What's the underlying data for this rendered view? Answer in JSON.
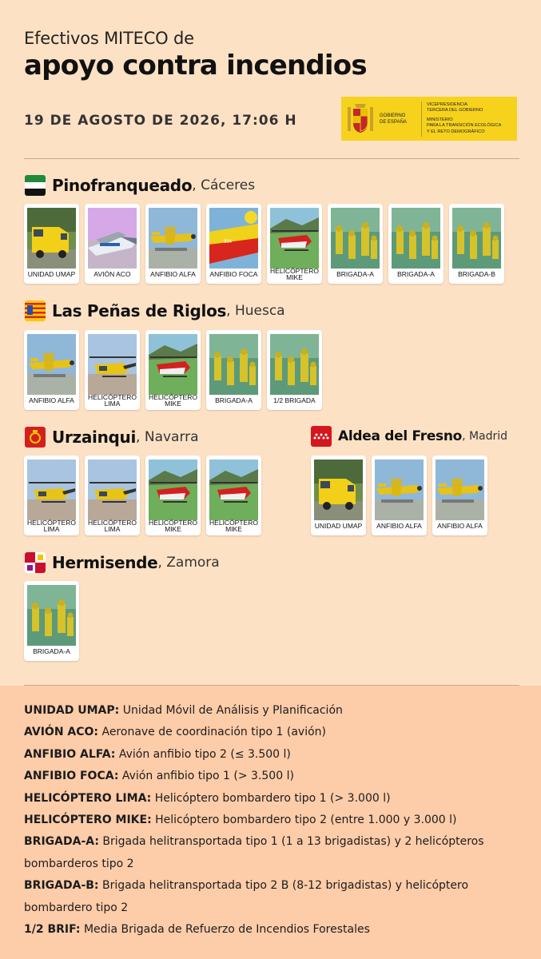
{
  "header": {
    "subtitle": "Efectivos MITECO de",
    "title": "apoyo contra incendios",
    "date": "19 DE AGOSTO DE 2026, 17:06 H"
  },
  "gov_logo": {
    "name_lines": [
      "GOBIERNO",
      "DE ESPAÑA"
    ],
    "ministry_lines": [
      "VICEPRESIDENCIA",
      "TERCERA DEL GOBIERNO",
      "MINISTERIO",
      "PARA LA TRANSICIÓN ECOLÓGICA",
      "Y EL RETO DEMOGRÁFICO"
    ],
    "color": "#f7d21d"
  },
  "locations": [
    {
      "name": "Pinofranqueado",
      "province": ", Cáceres",
      "flag": "extremadura-flag",
      "resources": [
        {
          "type": "truck",
          "label": "UNIDAD UMAP"
        },
        {
          "type": "aco",
          "label": "AVIÓN ACO"
        },
        {
          "type": "alfa",
          "label": "ANFIBIO ALFA"
        },
        {
          "type": "foca",
          "label": "ANFIBIO FOCA"
        },
        {
          "type": "mike",
          "label": "HELICÓPTERO MIKE"
        },
        {
          "type": "brigada",
          "label": "BRIGADA-A"
        },
        {
          "type": "brigada",
          "label": "BRIGADA-A"
        },
        {
          "type": "brigada",
          "label": "BRIGADA-B"
        }
      ]
    },
    {
      "name": "Las Peñas de Riglos",
      "province": ", Huesca",
      "flag": "aragon-flag",
      "resources": [
        {
          "type": "alfa",
          "label": "ANFIBIO ALFA"
        },
        {
          "type": "lima",
          "label": "HELICÓPTERO LIMA"
        },
        {
          "type": "mike",
          "label": "HELICÓPTERO MIKE"
        },
        {
          "type": "brigada",
          "label": "BRIGADA-A"
        },
        {
          "type": "brigada",
          "label": "1/2 BRIGADA"
        }
      ]
    },
    {
      "name": "Urzainqui",
      "province": ", Navarra",
      "flag": "navarra-flag",
      "resources": [
        {
          "type": "lima",
          "label": "HELICÓPTERO LIMA"
        },
        {
          "type": "lima",
          "label": "HELICÓPTERO LIMA"
        },
        {
          "type": "mike",
          "label": "HELICÓPTERO MIKE"
        },
        {
          "type": "mike",
          "label": "HELICÓPTERO MIKE"
        }
      ]
    },
    {
      "name": "Aldea del Fresno",
      "province": ", Madrid",
      "flag": "madrid-flag",
      "resources": [
        {
          "type": "truck",
          "label": "UNIDAD UMAP"
        },
        {
          "type": "alfa",
          "label": "ANFIBIO ALFA"
        },
        {
          "type": "alfa",
          "label": "ANFIBIO ALFA"
        }
      ]
    },
    {
      "name": "Hermisende",
      "province": ", Zamora",
      "flag": "castilla-leon-flag",
      "resources": [
        {
          "type": "brigada",
          "label": "BRIGADA-A"
        }
      ]
    }
  ],
  "legend": [
    {
      "term": "UNIDAD UMAP:",
      "desc": " Unidad Móvil de Análisis y Planificación"
    },
    {
      "term": "AVIÓN ACO:",
      "desc": " Aeronave de coordinación tipo 1 (avión)"
    },
    {
      "term": "ANFIBIO ALFA:",
      "desc": " Avión anfibio tipo 2 (≤ 3.500 l)"
    },
    {
      "term": "ANFIBIO FOCA:",
      "desc": " Avión anfibio tipo 1 (> 3.500 l)"
    },
    {
      "term": "HELICÓPTERO LIMA:",
      "desc": " Helicóptero bombardero tipo 1 (> 3.000 l)"
    },
    {
      "term": "HELICÓPTERO MIKE:",
      "desc": " Helicóptero bombardero tipo 2 (entre 1.000 y 3.000 l)"
    },
    {
      "term": "BRIGADA-A:",
      "desc": " Brigada helitransportada tipo 1 (1 a 13 brigadistas) y 2 helicópteros bombarderos tipo 2"
    },
    {
      "term": "BRIGADA-B:",
      "desc": " Brigada helitransportada tipo 2 B (8-12 brigadistas) y helicóptero bombardero tipo 2"
    },
    {
      "term": "1/2 BRIF:",
      "desc": " Media Brigada de Refuerzo de Incendios Forestales"
    }
  ],
  "colors": {
    "background": "#fde1c4",
    "legend_background": "#fdcca9",
    "rule": "#caa98a"
  }
}
